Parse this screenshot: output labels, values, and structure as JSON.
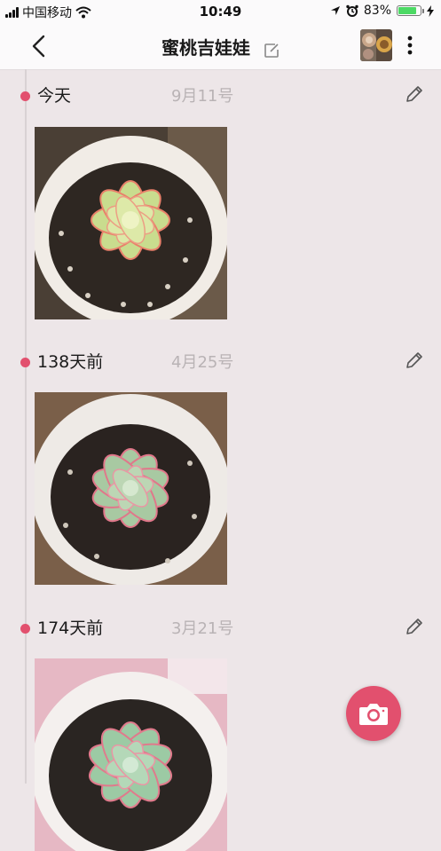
{
  "status_bar": {
    "carrier": "中国移动",
    "time": "10:49",
    "battery": "83%",
    "battery_level": 0.83
  },
  "nav": {
    "title": "蜜桃吉娃娃"
  },
  "entries": [
    {
      "label": "今天",
      "date": "9月11号"
    },
    {
      "label": "138天前",
      "date": "4月25号"
    },
    {
      "label": "174天前",
      "date": "3月21号"
    }
  ],
  "colors": {
    "accent": "#e2506e",
    "background": "#ede6e8",
    "date_text": "#b9b3b5"
  },
  "icons": {
    "back": "chevron-left-icon",
    "edit_title": "edit-icon",
    "more": "more-vertical-icon",
    "entry_edit": "pencil-icon",
    "fab": "camera-icon"
  }
}
